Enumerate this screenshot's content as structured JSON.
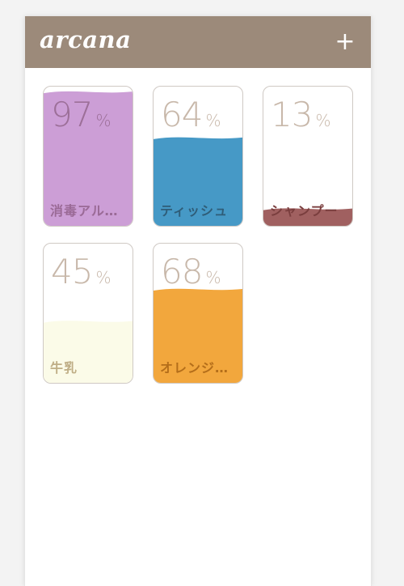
{
  "header": {
    "title": "arcana",
    "add_label": "+",
    "background_color": "#9c8a7a"
  },
  "items": [
    {
      "name": "消毒アルコール",
      "percent": "97",
      "unit": "%",
      "level": 97,
      "fill_color": "#cc9ed6",
      "percent_color": "#9c6f98",
      "label_color": "#9a6a96"
    },
    {
      "name": "ティッシュ",
      "percent": "64",
      "unit": "%",
      "level": 64,
      "fill_color": "#4699c6",
      "percent_color": "#c8b8aa",
      "label_color": "#2f5d78"
    },
    {
      "name": "シャンプー",
      "percent": "13",
      "unit": "%",
      "level": 13,
      "fill_color": "#a06060",
      "percent_color": "#c8b8aa",
      "label_color": "#7a3e3e"
    },
    {
      "name": "牛乳",
      "percent": "45",
      "unit": "%",
      "level": 45,
      "fill_color": "#fbfbe8",
      "percent_color": "#c8b8aa",
      "label_color": "#bfae86"
    },
    {
      "name": "オレンジジュース",
      "percent": "68",
      "unit": "%",
      "level": 68,
      "fill_color": "#f2a73d",
      "percent_color": "#c8b8aa",
      "label_color": "#b46e1a"
    }
  ]
}
